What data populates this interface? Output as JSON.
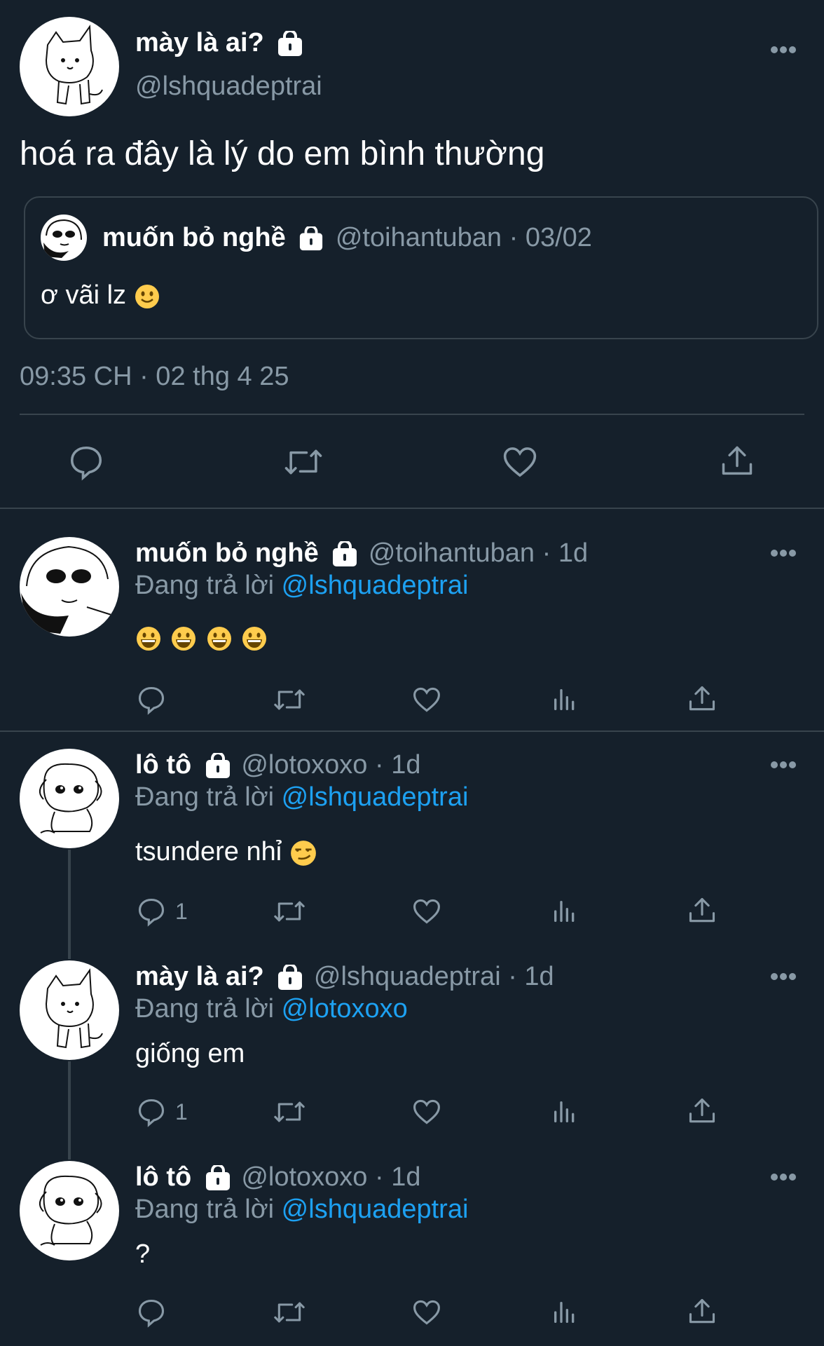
{
  "colors": {
    "background": "#15202b",
    "muted": "#8899a6",
    "link": "#1da1f2",
    "divider": "#38444d"
  },
  "main_tweet": {
    "name": "mày là ai?",
    "handle": "@lshquadeptrai",
    "text": "hoá ra đây là lý do em bình thường",
    "quote": {
      "name": "muốn bỏ nghề",
      "handle_date": "@toihantuban · 03/02",
      "text": "ơ vãi lz"
    },
    "timestamp": "09:35 CH · 02 thg 4 25",
    "actions": [
      "reply-icon",
      "retweet-icon",
      "like-icon",
      "share-icon"
    ]
  },
  "replies": [
    {
      "name": "muốn bỏ nghề",
      "handle_time": "@toihantuban · 1d",
      "replying_prefix": "Đang trả lời",
      "replying_to": "@lshquadeptrai",
      "text": "",
      "emojis": 4,
      "reply_count": ""
    },
    {
      "name": "lô tô",
      "handle_time": "@lotoxoxo · 1d",
      "replying_prefix": "Đang trả lời",
      "replying_to": "@lshquadeptrai",
      "text": "tsundere nhỉ",
      "reply_count": "1"
    },
    {
      "name": "mày là ai?",
      "handle_time": "@lshquadeptrai · 1d",
      "replying_prefix": "Đang trả lời",
      "replying_to": "@lotoxoxo",
      "text": "giống em",
      "reply_count": "1"
    },
    {
      "name": "lô tô",
      "handle_time": "@lotoxoxo · 1d",
      "replying_prefix": "Đang trả lời",
      "replying_to": "@lshquadeptrai",
      "text": "?",
      "reply_count": ""
    }
  ]
}
